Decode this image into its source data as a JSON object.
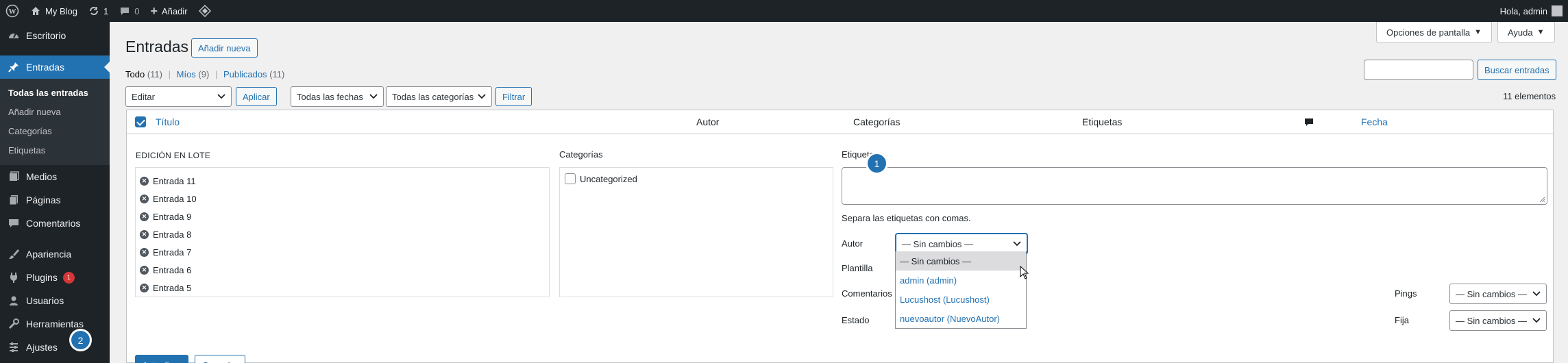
{
  "adminbar": {
    "wp_logo": "wordpress-icon",
    "site_name": "My Blog",
    "updates_count": "1",
    "comments_count": "0",
    "add_new_label": "Añadir",
    "greeting": "Hola, admin"
  },
  "sidebar": {
    "items": [
      {
        "label": "Escritorio",
        "icon": "dashboard-icon"
      },
      {
        "label": "Entradas",
        "icon": "pin-icon"
      },
      {
        "label": "Medios",
        "icon": "media-icon"
      },
      {
        "label": "Páginas",
        "icon": "pages-icon"
      },
      {
        "label": "Comentarios",
        "icon": "comments-icon"
      },
      {
        "label": "Apariencia",
        "icon": "brush-icon"
      },
      {
        "label": "Plugins",
        "icon": "plugin-icon",
        "badge": "1"
      },
      {
        "label": "Usuarios",
        "icon": "users-icon"
      },
      {
        "label": "Herramientas",
        "icon": "tools-icon"
      },
      {
        "label": "Ajustes",
        "icon": "settings-icon"
      }
    ],
    "submenu": [
      "Todas las entradas",
      "Añadir nueva",
      "Categorías",
      "Etiquetas"
    ]
  },
  "header": {
    "title": "Entradas",
    "add_new": "Añadir nueva",
    "screen_options": "Opciones de pantalla",
    "help": "Ayuda"
  },
  "filters": {
    "all_label": "Todo",
    "all_count": "(11)",
    "mine_label": "Míos",
    "mine_count": "(9)",
    "published_label": "Publicados",
    "published_count": "(11)",
    "search_button": "Buscar entradas",
    "bulk_select": "Editar",
    "apply": "Aplicar",
    "dates_select": "Todas las fechas",
    "categories_select": "Todas las categorías",
    "filter": "Filtrar",
    "items_count": "11 elementos"
  },
  "table": {
    "columns": {
      "title": "Título",
      "author": "Autor",
      "categories": "Categorías",
      "tags": "Etiquetas",
      "date": "Fecha"
    }
  },
  "bulk_edit": {
    "heading": "EDICIÓN EN LOTE",
    "posts": [
      "Entrada 11",
      "Entrada 10",
      "Entrada 9",
      "Entrada 8",
      "Entrada 7",
      "Entrada 6",
      "Entrada 5"
    ],
    "categories_label": "Categorías",
    "category_option": "Uncategorized",
    "tags_label": "Etiquetas",
    "tags_hint": "Separa las etiquetas con comas.",
    "author_label": "Autor",
    "author_value": "— Sin cambios —",
    "template_label": "Plantilla",
    "comments_label": "Comentarios",
    "status_label": "Estado",
    "pings_label": "Pings",
    "pings_value": "— Sin cambios —",
    "sticky_label": "Fija",
    "sticky_value": "— Sin cambios —",
    "author_options": [
      "— Sin cambios —",
      "admin (admin)",
      "Lucushost (Lucushost)",
      "nuevoautor (NuevoAutor)"
    ],
    "update_button": "Actualizar",
    "cancel_button": "Cancelar"
  },
  "steps": {
    "one": "1",
    "two": "2"
  }
}
